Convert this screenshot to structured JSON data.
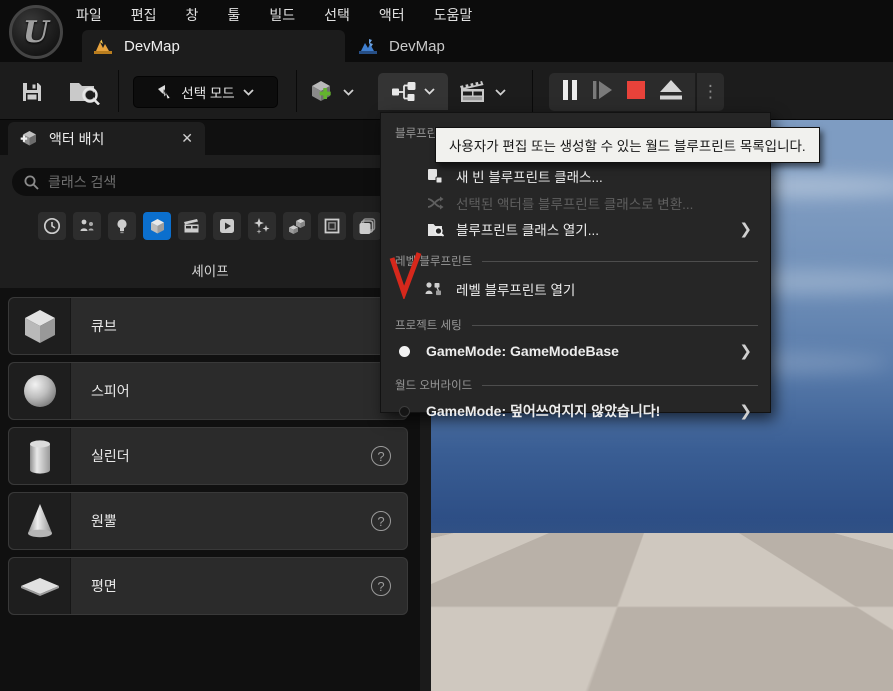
{
  "app": {
    "logo_letter": "U"
  },
  "menubar": {
    "items": [
      "파일",
      "편집",
      "창",
      "툴",
      "빌드",
      "선택",
      "액터",
      "도움말"
    ]
  },
  "tabs": {
    "active": {
      "label": "DevMap",
      "icon": "level-asset-orange-icon"
    },
    "inactive": {
      "label": "DevMap",
      "icon": "level-asset-blue-icon"
    }
  },
  "toolbar": {
    "mode_label": "선택 모드",
    "icons": [
      "save-icon",
      "browse-content-icon",
      "add-actor-cube-icon",
      "blueprints-icon",
      "cinematics-icon"
    ],
    "playback": [
      "pause-icon",
      "frame-skip-icon",
      "stop-icon",
      "eject-icon",
      "more-options-dots"
    ],
    "dots_glyph": "⋮"
  },
  "place_panel": {
    "title": "액터 배치",
    "close_glyph": "✕",
    "search_placeholder": "클래스 검색",
    "categories": [
      "recently-placed",
      "basic",
      "lights",
      "shapes",
      "cinematic",
      "media",
      "visual-effects",
      "geometry",
      "volumes",
      "all-classes"
    ],
    "selected_category_index": 3,
    "category_label": "셰이프",
    "items": [
      {
        "label": "큐브",
        "shape": "cube"
      },
      {
        "label": "스피어",
        "shape": "sphere"
      },
      {
        "label": "실린더",
        "shape": "cylinder",
        "help": "?"
      },
      {
        "label": "원뿔",
        "shape": "cone",
        "help": "?"
      },
      {
        "label": "평면",
        "shape": "plane",
        "help": "?"
      }
    ]
  },
  "blueprints_menu": {
    "sections": [
      {
        "header": "블루프린트",
        "items": [
          {
            "label": "새 빈 블루프린트 클래스...",
            "icon": "new-blueprint-icon",
            "disabled": false
          },
          {
            "label": "선택된 액터를 블루프린트 클래스로 변환...",
            "icon": "convert-actor-icon",
            "disabled": true
          },
          {
            "label": "블루프린트 클래스 열기...",
            "icon": "open-blueprint-icon",
            "submenu": "❯"
          }
        ]
      },
      {
        "header": "레벨 블루프린트",
        "items": [
          {
            "label": "레벨 블루프린트 열기",
            "icon": "level-blueprint-icon"
          }
        ]
      },
      {
        "header": "프로젝트 세팅",
        "items": [
          {
            "label": "GameMode: GameModeBase",
            "bullet": "white",
            "submenu": "❯"
          }
        ]
      },
      {
        "header": "월드 오버라이드",
        "items": [
          {
            "label": "GameMode: 덮어쓰여지지 않았습니다!",
            "bullet": "dark",
            "submenu": "❯"
          }
        ]
      }
    ]
  },
  "tooltip": {
    "text": "사용자가 편집 또는 생성할 수 있는 월드 블루프린트 목록입니다."
  },
  "colors": {
    "accent_blue": "#0b6fce",
    "stop_red": "#e8423a",
    "annotation_red": "#d6281c",
    "add_green": "#63b32e",
    "tab_icon_orange": "#e8a33d",
    "tab_icon_blue": "#3f7fd0"
  }
}
